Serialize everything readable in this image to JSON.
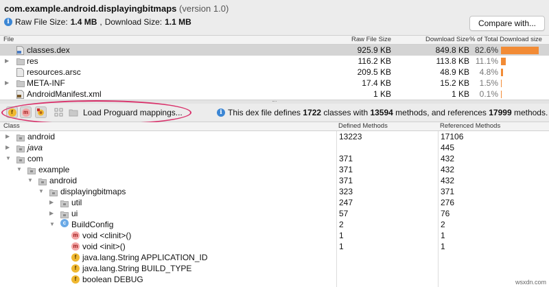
{
  "header": {
    "app_id": "com.example.android.displayingbitmaps",
    "version": "(version 1.0)",
    "raw_label": "Raw File Size: ",
    "raw_value": "1.4 MB",
    "sep": ", ",
    "download_label": "Download Size: ",
    "download_value": "1.1 MB",
    "compare_label": "Compare with..."
  },
  "file_table": {
    "columns": [
      "File",
      "Raw File Size",
      "Download Size",
      "% of Total Download size"
    ],
    "rows": [
      {
        "name": "classes.dex",
        "raw": "925.9 KB",
        "download": "849.8 KB",
        "percent": "82.6%",
        "share": 0.826,
        "expandable": false,
        "icon": "dex-file-icon",
        "selected": true
      },
      {
        "name": "res",
        "raw": "116.2 KB",
        "download": "113.8 KB",
        "percent": "11.1%",
        "share": 0.111,
        "expandable": true,
        "icon": "folder-icon",
        "selected": false
      },
      {
        "name": "resources.arsc",
        "raw": "209.5 KB",
        "download": "48.9 KB",
        "percent": "4.8%",
        "share": 0.048,
        "expandable": false,
        "icon": "file-icon",
        "selected": false
      },
      {
        "name": "META-INF",
        "raw": "17.4 KB",
        "download": "15.2 KB",
        "percent": "1.5%",
        "share": 0.015,
        "expandable": true,
        "icon": "folder-icon",
        "selected": false
      },
      {
        "name": "AndroidManifest.xml",
        "raw": "1 KB",
        "download": "1 KB",
        "percent": "0.1%",
        "share": 0.001,
        "expandable": false,
        "icon": "xml-file-icon",
        "selected": false
      }
    ]
  },
  "toolbar": {
    "show_fields_icon": "f",
    "show_methods_icon": "m",
    "load_proguard_label": "Load Proguard mappings...",
    "dex_info": {
      "prefix": "This dex file defines ",
      "classes": "1722",
      "mid1": " classes with ",
      "methods": "13594",
      "mid2": " methods, and references ",
      "refs": "17999",
      "suffix": " methods."
    }
  },
  "class_table": {
    "columns": [
      "Class",
      "Defined Methods",
      "Referenced Methods"
    ],
    "rows": [
      {
        "depth": 0,
        "arrow": "right",
        "icon": "package",
        "name": "android",
        "italic": false,
        "defined": "13223",
        "referenced": "17106"
      },
      {
        "depth": 0,
        "arrow": "right",
        "icon": "package",
        "name": "java",
        "italic": true,
        "defined": "",
        "referenced": "445"
      },
      {
        "depth": 0,
        "arrow": "down",
        "icon": "package",
        "name": "com",
        "italic": false,
        "defined": "371",
        "referenced": "432"
      },
      {
        "depth": 1,
        "arrow": "down",
        "icon": "package",
        "name": "example",
        "italic": false,
        "defined": "371",
        "referenced": "432"
      },
      {
        "depth": 2,
        "arrow": "down",
        "icon": "package",
        "name": "android",
        "italic": false,
        "defined": "371",
        "referenced": "432"
      },
      {
        "depth": 3,
        "arrow": "down",
        "icon": "package",
        "name": "displayingbitmaps",
        "italic": false,
        "defined": "323",
        "referenced": "371"
      },
      {
        "depth": 4,
        "arrow": "right",
        "icon": "package",
        "name": "util",
        "italic": false,
        "defined": "247",
        "referenced": "276"
      },
      {
        "depth": 4,
        "arrow": "right",
        "icon": "package",
        "name": "ui",
        "italic": false,
        "defined": "57",
        "referenced": "76"
      },
      {
        "depth": 4,
        "arrow": "down",
        "icon": "class",
        "name": "BuildConfig",
        "italic": false,
        "defined": "2",
        "referenced": "2"
      },
      {
        "depth": 5,
        "arrow": "none",
        "icon": "method",
        "name": "void <clinit>()",
        "italic": false,
        "defined": "1",
        "referenced": "1"
      },
      {
        "depth": 5,
        "arrow": "none",
        "icon": "method",
        "name": "void <init>()",
        "italic": false,
        "defined": "1",
        "referenced": "1"
      },
      {
        "depth": 5,
        "arrow": "none",
        "icon": "field",
        "name": "java.lang.String APPLICATION_ID",
        "italic": false,
        "defined": "",
        "referenced": ""
      },
      {
        "depth": 5,
        "arrow": "none",
        "icon": "field",
        "name": "java.lang.String BUILD_TYPE",
        "italic": false,
        "defined": "",
        "referenced": ""
      },
      {
        "depth": 5,
        "arrow": "none",
        "icon": "field",
        "name": "boolean DEBUG",
        "italic": false,
        "defined": "",
        "referenced": ""
      }
    ]
  },
  "watermark": "wsxdn.com",
  "colors": {
    "bar": "#f28b35",
    "highlight_ring": "#d9306a",
    "info": "#3b86d4"
  }
}
